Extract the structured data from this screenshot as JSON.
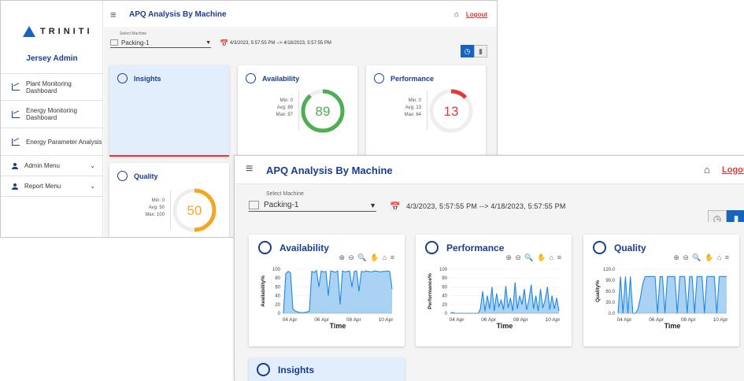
{
  "brand": "TRINITI",
  "user": "Jersey Admin",
  "sidebar": {
    "items": [
      {
        "label": "Plant Monitoring Dashboard"
      },
      {
        "label": "Energy Monitoring Dashboard"
      },
      {
        "label": "Energy Parameter Analysis"
      }
    ],
    "menus": [
      {
        "label": "Admin Menu"
      },
      {
        "label": "Report Menu"
      }
    ]
  },
  "header": {
    "title": "APQ Analysis By Machine",
    "logout": "Logout",
    "logout_partial": "Logou"
  },
  "filter": {
    "select_label": "Select Machine",
    "machine": "Packing-1",
    "range": "4/3/2023, 5:57:55 PM --> 4/18/2023, 5:57:55 PM"
  },
  "gauges": {
    "insights": {
      "title": "Insights",
      "accent": "#e53935"
    },
    "availability": {
      "title": "Availability",
      "min": "Min: 0",
      "avg": "Avg: 89",
      "max": "Max: 97",
      "value": 89,
      "display": "89",
      "color": "#4caf50"
    },
    "performance": {
      "title": "Performance",
      "min": "Min: 0",
      "avg": "Avg: 13",
      "max": "Max: 64",
      "value": 13,
      "display": "13",
      "color": "#e53935"
    },
    "quality": {
      "title": "Quality",
      "min": "Min: 0",
      "avg": "Avg: 50",
      "max": "Max: 100",
      "value": 50,
      "display": "50",
      "color": "#f5a623"
    }
  },
  "chart_data": [
    {
      "type": "area",
      "title": "Availability",
      "xlabel": "Time",
      "ylabel": "Availability%",
      "ylim": [
        0,
        100
      ],
      "yticks": [
        "100",
        "80",
        "60",
        "40",
        "20",
        "0"
      ],
      "xticks": [
        "04 Apr",
        "06 Apr",
        "08 Apr",
        "10 Apr"
      ],
      "series": [
        {
          "values": [
            0,
            90,
            95,
            92,
            10,
            5,
            3,
            2,
            1,
            2,
            3,
            5,
            95,
            93,
            97,
            60,
            96,
            94,
            95,
            40,
            96,
            95,
            93,
            96,
            20,
            96,
            94,
            95,
            96,
            60,
            95,
            96,
            50,
            95,
            94,
            96,
            95,
            94,
            95,
            96,
            95,
            94,
            95,
            95,
            96,
            95,
            55
          ]
        }
      ]
    },
    {
      "type": "area",
      "title": "Performance",
      "xlabel": "Time",
      "ylabel": "Performance%",
      "ylim": [
        0,
        100
      ],
      "yticks": [
        "100",
        "80",
        "60",
        "40",
        "20",
        "0"
      ],
      "xticks": [
        "04 Apr",
        "06 Apr",
        "08 Apr",
        "10 Apr"
      ],
      "series": [
        {
          "values": [
            0,
            2,
            0,
            0,
            0,
            0,
            0,
            0,
            0,
            0,
            0,
            0,
            0,
            10,
            50,
            5,
            40,
            10,
            60,
            5,
            45,
            15,
            30,
            8,
            62,
            12,
            35,
            5,
            70,
            10,
            40,
            20,
            55,
            8,
            30,
            65,
            10,
            40,
            5,
            55,
            12,
            30,
            60,
            8,
            40,
            10,
            35,
            5
          ]
        }
      ]
    },
    {
      "type": "area",
      "title": "Quality",
      "xlabel": "Time",
      "ylabel": "Quality%",
      "ylim": [
        0,
        120
      ],
      "yticks": [
        "120.0",
        "90.0",
        "60.0",
        "30.0",
        "0.0"
      ],
      "xticks": [
        "04 Apr",
        "06 Apr",
        "08 Apr",
        "10 Apr"
      ],
      "series": [
        {
          "values": [
            0,
            100,
            0,
            100,
            0,
            100,
            0,
            0,
            10,
            40,
            80,
            100,
            100,
            100,
            100,
            100,
            0,
            100,
            100,
            0,
            100,
            100,
            100,
            100,
            0,
            100,
            100,
            100,
            0,
            100,
            100,
            0,
            100,
            100,
            100,
            0,
            100,
            100,
            100,
            100,
            0,
            100,
            100,
            100,
            100
          ]
        }
      ]
    }
  ],
  "insights_bottom": {
    "title": "Insights"
  }
}
